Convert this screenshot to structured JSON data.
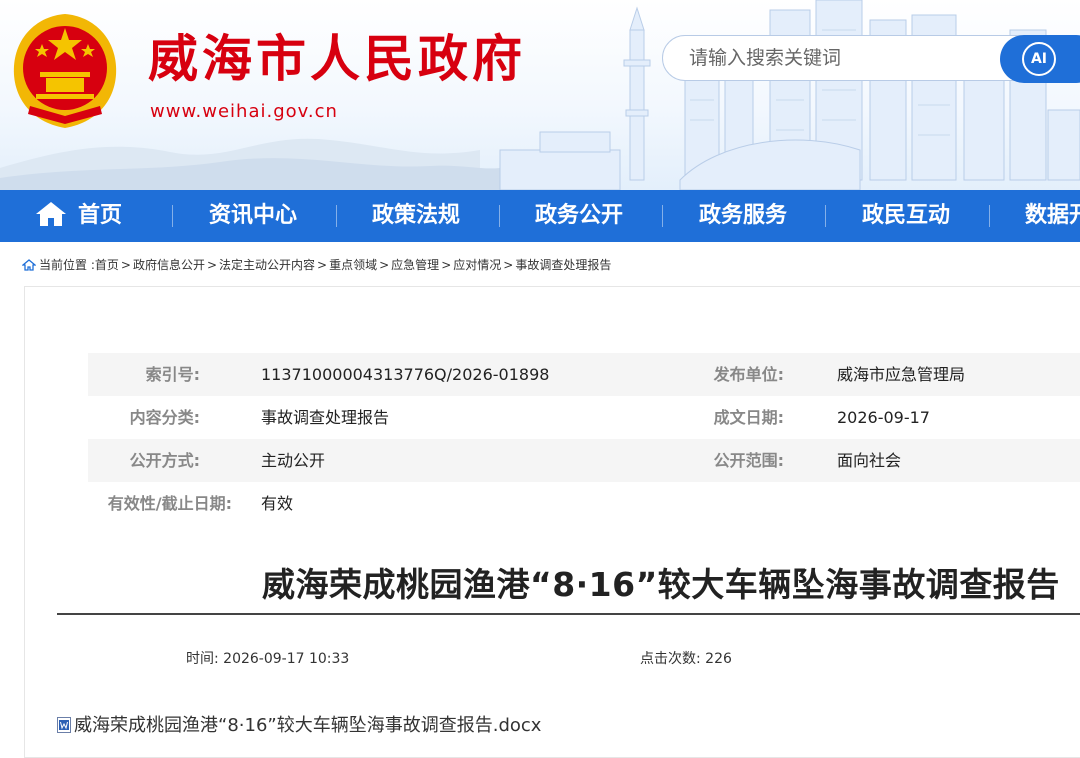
{
  "header": {
    "site_title": "威海市人民政府",
    "site_url": "www.weihai.gov.cn",
    "search_placeholder": "请输入搜索关键词",
    "search_button_label": "AI"
  },
  "nav": {
    "items": [
      {
        "label": "首页",
        "icon": "home-icon"
      },
      {
        "label": "资讯中心"
      },
      {
        "label": "政策法规"
      },
      {
        "label": "政务公开"
      },
      {
        "label": "政务服务"
      },
      {
        "label": "政民互动"
      },
      {
        "label": "数据开"
      }
    ]
  },
  "breadcrumb": {
    "prefix": "当前位置 :",
    "items": [
      "首页",
      "政府信息公开",
      "法定主动公开内容",
      "重点领域",
      "应急管理",
      "应对情况",
      "事故调查处理报告"
    ],
    "separator": ">"
  },
  "meta": {
    "index_label": "索引号:",
    "index_value": "11371000004313776Q/2026-01898",
    "publisher_label": "发布单位:",
    "publisher_value": "威海市应急管理局",
    "category_label": "内容分类:",
    "category_value": "事故调查处理报告",
    "date_label": "成文日期:",
    "date_value": "2026-09-17",
    "method_label": "公开方式:",
    "method_value": "主动公开",
    "scope_label": "公开范围:",
    "scope_value": "面向社会",
    "validity_label": "有效性/截止日期:",
    "validity_value": "有效"
  },
  "article": {
    "title": "威海荣成桃园渔港“8·16”较大车辆坠海事故调查报告",
    "time_label": "时间:",
    "time_value": "2026-09-17 10:33",
    "clicks_label": "点击次数:",
    "clicks_value": "226",
    "attachment_name": "威海荣成桃园渔港“8·16”较大车辆坠海事故调查报告.docx"
  },
  "colors": {
    "brand_red": "#d7000f",
    "nav_blue": "#1f6fd8"
  }
}
